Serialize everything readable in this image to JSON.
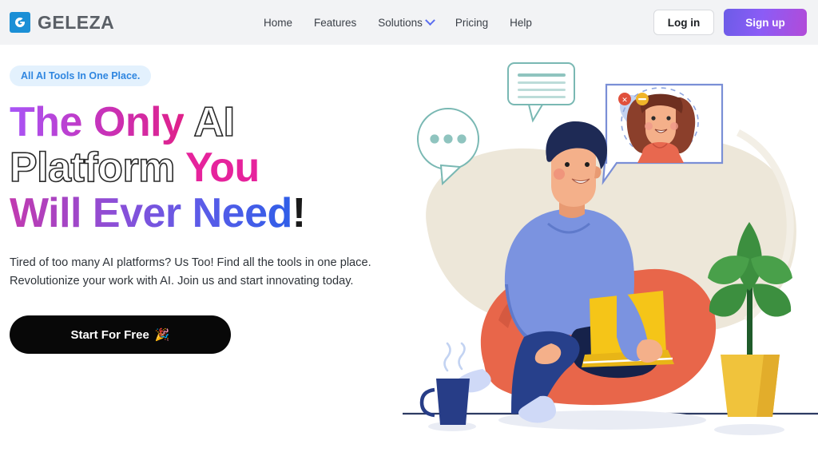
{
  "header": {
    "logo_icon": "geleza-logo-icon",
    "brand_name": "GELEZA",
    "brand_color": "#1b8fd6",
    "nav": [
      {
        "label": "Home",
        "has_chevron": false
      },
      {
        "label": "Features",
        "has_chevron": false
      },
      {
        "label": "Solutions",
        "has_chevron": true
      },
      {
        "label": "Pricing",
        "has_chevron": false
      },
      {
        "label": "Help",
        "has_chevron": false
      }
    ],
    "login_label": "Log in",
    "signup_label": "Sign up",
    "signup_gradient_from": "#6c5ce7",
    "signup_gradient_to": "#b24bd8"
  },
  "hero": {
    "badge": "All AI Tools In One Place.",
    "badge_color": "#2f86e0",
    "badge_background": "#e3f1fd",
    "headline": {
      "line1_gradient": "The Only",
      "line1_outline": "AI",
      "line2_outline": "Platform",
      "line2_pink": "You",
      "line3_gradient": "Will Ever Need",
      "line3_bang": "!"
    },
    "paragraph_line1": "Tired of too many AI platforms? Us Too! Find all the tools in one place.",
    "paragraph_line2": "Revolutionize your work with AI. Join us and start innovating today.",
    "cta_label": "Start For Free",
    "cta_emoji": "🎉",
    "cta_background": "#080808"
  },
  "illustration": {
    "name": "person-on-beanbag-with-laptop-video-call",
    "blob_color": "#ede7d9",
    "beanbag_color": "#e8664a",
    "sweater_color": "#7b93e0",
    "hair_color": "#1e2a55",
    "jeans_color": "#27408b",
    "laptop_color": "#f5c518",
    "sock_color": "#cfd9f7",
    "mug_color": "#273d87",
    "plant_leaf_color": "#3c8f3f",
    "plant_pot_color": "#f0c33c",
    "bubble_stroke": "#79b8b3",
    "window_stroke": "#7a8fd6",
    "woman_shirt_color": "#e8684f",
    "woman_hair_color": "#8b3f2b",
    "close_button_color": "#e0503c",
    "minimize_button_color": "#f0b429",
    "floor_line_color": "#2d3b63"
  }
}
